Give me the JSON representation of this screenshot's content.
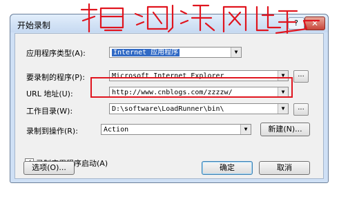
{
  "window": {
    "title": "开始录制",
    "help_glyph": "?",
    "close_glyph": "✕"
  },
  "fields": {
    "app_type_label": "应用程序类型(A):",
    "app_type_value": "Internet 应用程序",
    "program_label": "要录制的程序(P):",
    "program_value": "Microsoft Internet Explorer",
    "url_label": "URL 地址(U):",
    "url_value": "http://www.cnblogs.com/zzzzw/",
    "workdir_label": "工作目录(W):",
    "workdir_value": "D:\\software\\LoadRunner\\bin\\",
    "record_into_label": "录制到操作(R):",
    "record_into_value": "Action",
    "browse_label": "...",
    "new_button": "新建(N)..."
  },
  "checkbox": {
    "label": "录制应用程序启动(A)",
    "checked": true,
    "mark": "✓"
  },
  "buttons": {
    "options": "选项(O)...",
    "ok": "确定",
    "cancel": "取消"
  },
  "icons": {
    "dropdown": "chevron-down-icon"
  },
  "annotation": {
    "color": "#e0141e"
  }
}
